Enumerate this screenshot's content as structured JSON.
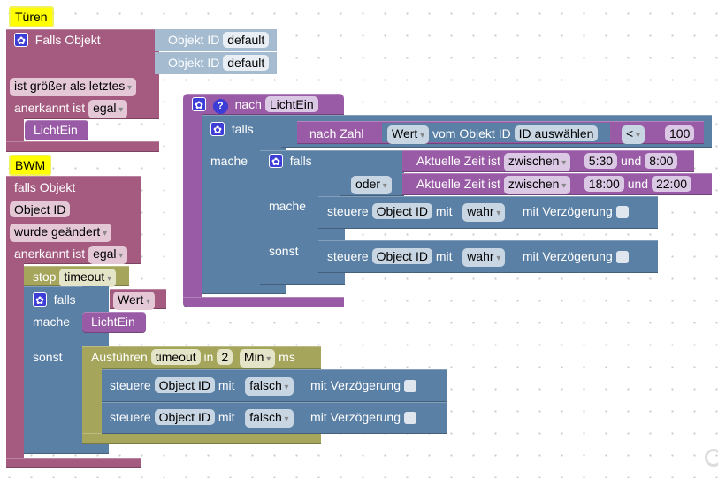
{
  "colors": {
    "trigger": "#a55b80",
    "function": "#995ba5",
    "logic": "#5b80a5",
    "timeout": "#a5a55b",
    "object_id": "#a5bbd0",
    "comment": "#ffff00"
  },
  "tueren": {
    "comment": "Türen",
    "label": "Falls Objekt",
    "obj1_label": "Objekt ID",
    "obj1_value": "default",
    "obj2_label": "Objekt ID",
    "obj2_value": "default",
    "condition": "ist größer als letztes",
    "ack_label": "anerkannt ist",
    "ack_value": "egal",
    "call": "LichtEin"
  },
  "bwm": {
    "comment": "BWM",
    "label": "falls Objekt",
    "object": "Object ID",
    "condition": "wurde geändert",
    "ack_label": "anerkannt ist",
    "ack_value": "egal",
    "stop_label": "stop",
    "stop_value": "timeout",
    "if_label": "falls",
    "if_value": "Wert",
    "do_label": "mache",
    "do_call": "LichtEin",
    "else_label": "sonst",
    "run_label": "Ausführen",
    "run_name": "timeout",
    "in_label": "in",
    "in_value": "2",
    "unit": "Min",
    "ms": "ms",
    "set1": {
      "label": "steuere",
      "object": "Object ID",
      "with": "mit",
      "value": "falsch",
      "delay": "mit Verzögerung"
    },
    "set2": {
      "label": "steuere",
      "object": "Object ID",
      "with": "mit",
      "value": "falsch",
      "delay": "mit Verzögerung"
    }
  },
  "func": {
    "label": "nach",
    "name": "LichtEin",
    "if_label": "falls",
    "to_number": "nach Zahl",
    "prop": "Wert",
    "of_object": "vom Objekt ID",
    "id_select": "ID auswählen",
    "op": "<",
    "compare": "100",
    "do_label": "mache",
    "inner": {
      "if_label": "falls",
      "time1": {
        "label": "Aktuelle Zeit ist",
        "mode": "zwischen",
        "from": "5:30",
        "and": "und",
        "to": "8:00"
      },
      "or": "oder",
      "time2": {
        "label": "Aktuelle Zeit ist",
        "mode": "zwischen",
        "from": "18:00",
        "and": "und",
        "to": "22:00"
      },
      "do_label": "mache",
      "else_label": "sonst",
      "set1": {
        "label": "steuere",
        "object": "Object ID",
        "with": "mit",
        "value": "wahr",
        "delay": "mit Verzögerung"
      },
      "set2": {
        "label": "steuere",
        "object": "Object ID",
        "with": "mit",
        "value": "wahr",
        "delay": "mit Verzögerung"
      }
    }
  }
}
